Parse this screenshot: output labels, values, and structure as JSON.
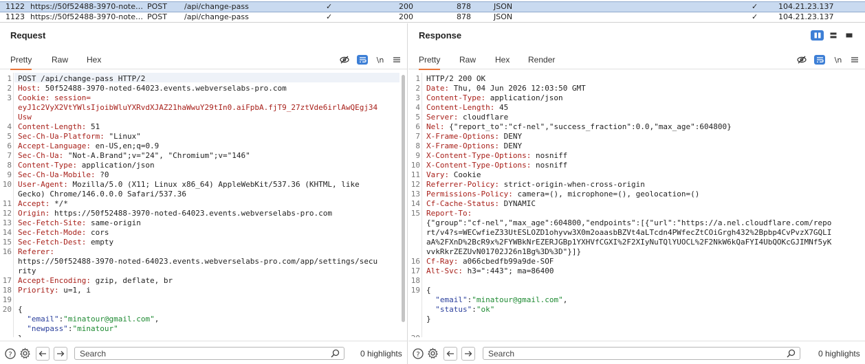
{
  "history": {
    "rows": [
      {
        "num": "1122",
        "host": "https://50f52488-3970-noted-...",
        "method": "POST",
        "url": "/api/change-pass",
        "params": "✓",
        "status": "200",
        "length": "878",
        "mime": "JSON",
        "tls": "✓",
        "ip": "104.21.23.137",
        "selected": true
      },
      {
        "num": "1123",
        "host": "https://50f52488-3970-noted-...",
        "method": "POST",
        "url": "/api/change-pass",
        "params": "✓",
        "status": "200",
        "length": "878",
        "mime": "JSON",
        "tls": "✓",
        "ip": "104.21.23.137",
        "selected": false
      }
    ]
  },
  "request": {
    "title": "Request",
    "tabs": [
      "Pretty",
      "Raw",
      "Hex"
    ],
    "newline_label": "\\n",
    "lines": [
      {
        "n": "1",
        "k": "",
        "v": "POST /api/change-pass HTTP/2"
      },
      {
        "n": "2",
        "k": "Host:",
        "v": " 50f52488-3970-noted-64023.events.webverselabs-pro.com"
      },
      {
        "n": "3",
        "k": "Cookie: session=",
        "v": ""
      },
      {
        "n": "",
        "k": "eyJ1c2VyX2VtYWlsIjoibWluYXRvdXJAZ21haWwuY29tIn0.aiFpbA.fjT9_27ztVde6irlAwQEgj34",
        "v": ""
      },
      {
        "n": "",
        "k": "Usw",
        "v": ""
      },
      {
        "n": "4",
        "k": "Content-Length:",
        "v": " 51"
      },
      {
        "n": "5",
        "k": "Sec-Ch-Ua-Platform:",
        "v": " \"Linux\""
      },
      {
        "n": "6",
        "k": "Accept-Language:",
        "v": " en-US,en;q=0.9"
      },
      {
        "n": "7",
        "k": "Sec-Ch-Ua:",
        "v": " \"Not-A.Brand\";v=\"24\", \"Chromium\";v=\"146\""
      },
      {
        "n": "8",
        "k": "Content-Type:",
        "v": " application/json"
      },
      {
        "n": "9",
        "k": "Sec-Ch-Ua-Mobile:",
        "v": " ?0"
      },
      {
        "n": "10",
        "k": "User-Agent:",
        "v": " Mozilla/5.0 (X11; Linux x86_64) AppleWebKit/537.36 (KHTML, like"
      },
      {
        "n": "",
        "k": "",
        "v": "Gecko) Chrome/146.0.0.0 Safari/537.36"
      },
      {
        "n": "11",
        "k": "Accept:",
        "v": " */*"
      },
      {
        "n": "12",
        "k": "Origin:",
        "v": " https://50f52488-3970-noted-64023.events.webverselabs-pro.com"
      },
      {
        "n": "13",
        "k": "Sec-Fetch-Site:",
        "v": " same-origin"
      },
      {
        "n": "14",
        "k": "Sec-Fetch-Mode:",
        "v": " cors"
      },
      {
        "n": "15",
        "k": "Sec-Fetch-Dest:",
        "v": " empty"
      },
      {
        "n": "16",
        "k": "Referer:",
        "v": ""
      },
      {
        "n": "",
        "k": "",
        "v": "https://50f52488-3970-noted-64023.events.webverselabs-pro.com/app/settings/secu"
      },
      {
        "n": "",
        "k": "",
        "v": "rity"
      },
      {
        "n": "17",
        "k": "Accept-Encoding:",
        "v": " gzip, deflate, br"
      },
      {
        "n": "18",
        "k": "Priority:",
        "v": " u=1, i"
      },
      {
        "n": "19",
        "k": "",
        "v": ""
      },
      {
        "n": "20",
        "k": "",
        "v": "{"
      },
      {
        "n": "",
        "jk": "  \"email\"",
        "sep": ":",
        "jv": "\"minatour@gmail.com\"",
        "tail": ","
      },
      {
        "n": "",
        "jk": "  \"newpass\"",
        "sep": ":",
        "jv": "\"minatour\"",
        "tail": ""
      },
      {
        "n": "",
        "k": "",
        "v": "}"
      }
    ],
    "search_placeholder": "Search",
    "highlights": "0 highlights"
  },
  "response": {
    "title": "Response",
    "tabs": [
      "Pretty",
      "Raw",
      "Hex",
      "Render"
    ],
    "newline_label": "\\n",
    "lines": [
      {
        "n": "1",
        "k": "",
        "v": "HTTP/2 200 OK"
      },
      {
        "n": "2",
        "k": "Date:",
        "v": " Thu, 04 Jun 2026 12:03:50 GMT"
      },
      {
        "n": "3",
        "k": "Content-Type:",
        "v": " application/json"
      },
      {
        "n": "4",
        "k": "Content-Length:",
        "v": " 45"
      },
      {
        "n": "5",
        "k": "Server:",
        "v": " cloudflare"
      },
      {
        "n": "6",
        "k": "Nel:",
        "v": " {\"report_to\":\"cf-nel\",\"success_fraction\":0.0,\"max_age\":604800}"
      },
      {
        "n": "7",
        "k": "X-Frame-Options:",
        "v": " DENY"
      },
      {
        "n": "8",
        "k": "X-Frame-Options:",
        "v": " DENY"
      },
      {
        "n": "9",
        "k": "X-Content-Type-Options:",
        "v": " nosniff"
      },
      {
        "n": "10",
        "k": "X-Content-Type-Options:",
        "v": " nosniff"
      },
      {
        "n": "11",
        "k": "Vary:",
        "v": " Cookie"
      },
      {
        "n": "12",
        "k": "Referrer-Policy:",
        "v": " strict-origin-when-cross-origin"
      },
      {
        "n": "13",
        "k": "Permissions-Policy:",
        "v": " camera=(), microphone=(), geolocation=()"
      },
      {
        "n": "14",
        "k": "Cf-Cache-Status:",
        "v": " DYNAMIC"
      },
      {
        "n": "15",
        "k": "Report-To:",
        "v": ""
      },
      {
        "n": "",
        "k": "",
        "v": "{\"group\":\"cf-nel\",\"max_age\":604800,\"endpoints\":[{\"url\":\"https://a.nel.cloudflare.com/repo"
      },
      {
        "n": "",
        "k": "",
        "v": "rt/v4?s=WECwfieZ33UtESLOZD1ohyvw3X0m2oaasbBZVt4aLTcdn4PWfecZtCOiGrgh432%2Bpbp4CvPvzX7GQLI"
      },
      {
        "n": "",
        "k": "",
        "v": "aA%2FXnD%2BcR9x%2FYWBkNrEZERJGBp1YXHVfCGXI%2F2XIyNuTQlYUOCL%2F2NkW6kQaFYI4UbQOKcGJIMNf5yK"
      },
      {
        "n": "",
        "k": "",
        "v": "vvkRkrZEZUvN01702J26n1Bg%3D%3D\"}]}"
      },
      {
        "n": "16",
        "k": "Cf-Ray:",
        "v": " a066cbedfb99a9de-SOF"
      },
      {
        "n": "17",
        "k": "Alt-Svc:",
        "v": " h3=\":443\"; ma=86400"
      },
      {
        "n": "18",
        "k": "",
        "v": ""
      },
      {
        "n": "19",
        "k": "",
        "v": "{"
      },
      {
        "n": "",
        "jk": "  \"email\"",
        "sep": ":",
        "jv": "\"minatour@gmail.com\"",
        "tail": ","
      },
      {
        "n": "",
        "jk": "  \"status\"",
        "sep": ":",
        "jv": "\"ok\"",
        "tail": ""
      },
      {
        "n": "",
        "k": "",
        "v": "}"
      },
      {
        "n": "",
        "k": "",
        "v": ""
      },
      {
        "n": "20",
        "k": "",
        "v": ""
      }
    ],
    "search_placeholder": "Search",
    "highlights": "0 highlights"
  },
  "icons": {
    "hide": "eye-slash-icon",
    "wrap": "word-wrap-icon",
    "newline": "newline-icon",
    "menu": "hamburger-menu-icon",
    "help": "help-icon",
    "settings": "gear-icon",
    "back": "arrow-left-icon",
    "forward": "arrow-right-icon",
    "search": "search-icon"
  },
  "colors": {
    "accent": "#e8753a",
    "selected_row": "#c9daf0",
    "header_key": "#a8201a",
    "json_key": "#2a3f9c",
    "json_string": "#1e8a32",
    "toggle_blue": "#3d7fd6"
  }
}
